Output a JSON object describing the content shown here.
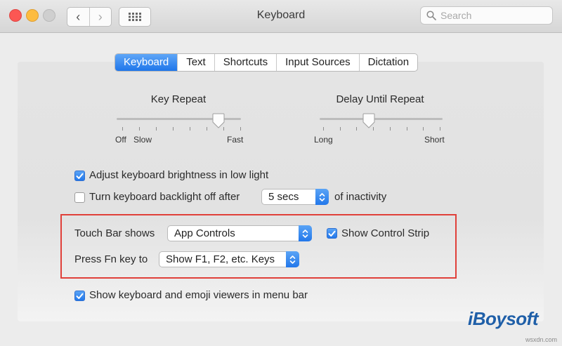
{
  "window": {
    "title": "Keyboard"
  },
  "search": {
    "placeholder": "Search"
  },
  "tabs": [
    "Keyboard",
    "Text",
    "Shortcuts",
    "Input Sources",
    "Dictation"
  ],
  "active_tab": "Keyboard",
  "key_repeat": {
    "label": "Key Repeat",
    "left": "Off",
    "left2": "Slow",
    "right": "Fast",
    "value_fraction": 0.83
  },
  "delay_until_repeat": {
    "label": "Delay Until Repeat",
    "left": "Long",
    "right": "Short",
    "value_fraction": 0.4
  },
  "options": {
    "brightness": {
      "label": "Adjust keyboard brightness in low light",
      "checked": true
    },
    "backlight": {
      "label": "Turn keyboard backlight off after",
      "checked": false,
      "value": "5 secs",
      "suffix": "of inactivity"
    },
    "touchbar": {
      "label": "Touch Bar shows",
      "value": "App Controls"
    },
    "control_strip": {
      "label": "Show Control Strip",
      "checked": true
    },
    "fn_key": {
      "label": "Press Fn key to",
      "value": "Show F1, F2, etc. Keys"
    },
    "viewers": {
      "label": "Show keyboard and emoji viewers in menu bar",
      "checked": true
    }
  },
  "branding": {
    "logo": "iBoysoft",
    "watermark": "wsxdn.com"
  },
  "colors": {
    "accent": "#2277ea",
    "highlight_box": "#e0403a",
    "logo": "#1f5fa8"
  }
}
